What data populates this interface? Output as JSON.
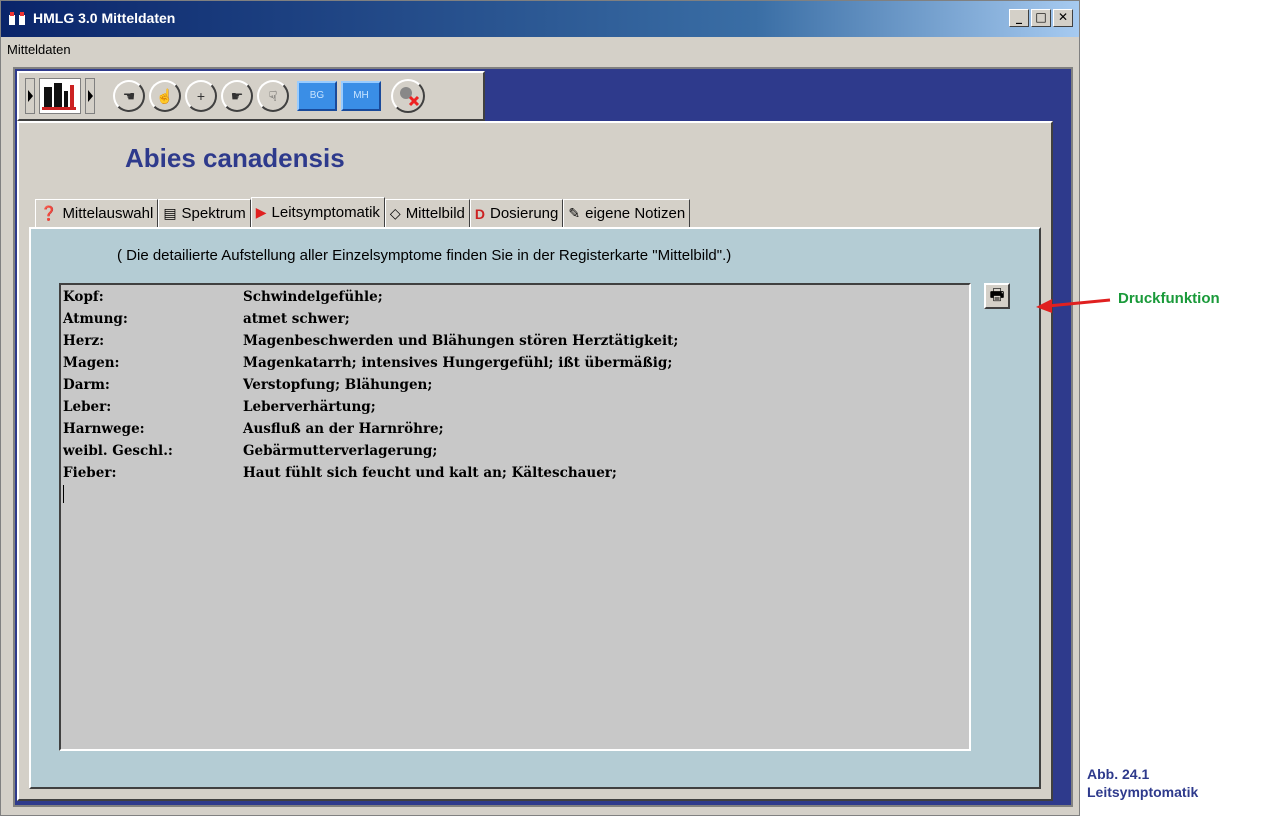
{
  "window": {
    "title": "HMLG 3.0 Mitteldaten",
    "controls": {
      "minimize": "_",
      "maximize": "□",
      "close": "✕"
    }
  },
  "menubar": {
    "items": [
      "Mitteldaten"
    ]
  },
  "toolbar": {
    "blue_buttons": [
      "BG",
      "MH"
    ]
  },
  "remedy_name": "Abies canadensis",
  "tabs": [
    {
      "label": "Mittelauswahl",
      "icon": "bottle-question-icon"
    },
    {
      "label": "Spektrum",
      "icon": "spectrum-icon"
    },
    {
      "label": "Leitsymptomatik",
      "icon": "play-arrow-icon",
      "active": true
    },
    {
      "label": "Mittelbild",
      "icon": "diamond-icon"
    },
    {
      "label": "Dosierung",
      "icon": "dosage-icon"
    },
    {
      "label": "eigene Notizen",
      "icon": "notes-icon"
    }
  ],
  "hint": "( Die detailierte Aufstellung aller Einzelsymptome finden Sie in der Registerkarte \"Mittelbild\".)",
  "symptoms": [
    {
      "area": "Kopf:",
      "text": "Schwindelgefühle;"
    },
    {
      "area": "Atmung:",
      "text": "atmet schwer;"
    },
    {
      "area": "Herz:",
      "text": "Magenbeschwerden und Blähungen stören Herztätigkeit;"
    },
    {
      "area": "Magen:",
      "text": "Magenkatarrh; intensives Hungergefühl; ißt übermäßig;"
    },
    {
      "area": "Darm:",
      "text": "Verstopfung; Blähungen;"
    },
    {
      "area": "Leber:",
      "text": "Leberverhärtung;"
    },
    {
      "area": "Harnwege:",
      "text": "Ausfluß an der Harnröhre;"
    },
    {
      "area": "weibl. Geschl.:",
      "text": "Gebärmutterverlagerung;"
    },
    {
      "area": "Fieber:",
      "text": "Haut fühlt sich feucht und kalt an; Kälteschauer;"
    }
  ],
  "annotation": {
    "label": "Druckfunktion",
    "color": "#1a9a3a",
    "arrow_color": "#e02020"
  },
  "caption": {
    "line1": "Abb. 24.1",
    "line2": "Leitsymptomatik"
  },
  "colors": {
    "accent": "#2e3a8c",
    "tabpage_bg": "#b4ccd4",
    "textbox_bg": "#c8c8c8"
  }
}
